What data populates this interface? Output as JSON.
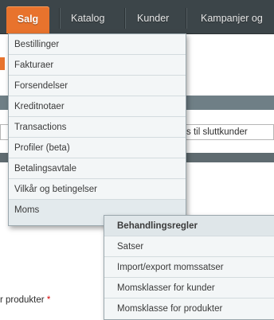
{
  "nav": {
    "items": [
      {
        "label": "Salg"
      },
      {
        "label": "Katalog"
      },
      {
        "label": "Kunder"
      },
      {
        "label": "Kampanjer og"
      }
    ]
  },
  "background": {
    "tax_text": "s til sluttkunder",
    "field_label": "r produkter",
    "required_mark": "*"
  },
  "salg_menu": {
    "items": [
      {
        "label": "Bestillinger"
      },
      {
        "label": "Fakturaer"
      },
      {
        "label": "Forsendelser"
      },
      {
        "label": "Kreditnotaer"
      },
      {
        "label": "Transactions"
      },
      {
        "label": "Profiler (beta)"
      },
      {
        "label": "Betalingsavtale"
      },
      {
        "label": "Vilkår og betingelser"
      },
      {
        "label": "Moms"
      }
    ]
  },
  "moms_submenu": {
    "items": [
      {
        "label": "Behandlingsregler"
      },
      {
        "label": "Satser"
      },
      {
        "label": "Import/export momssatser"
      },
      {
        "label": "Momsklasser for kunder"
      },
      {
        "label": "Momsklasse for produkter"
      }
    ]
  },
  "colors": {
    "active_tab": "#e8732d",
    "topbar": "#3c4549"
  }
}
